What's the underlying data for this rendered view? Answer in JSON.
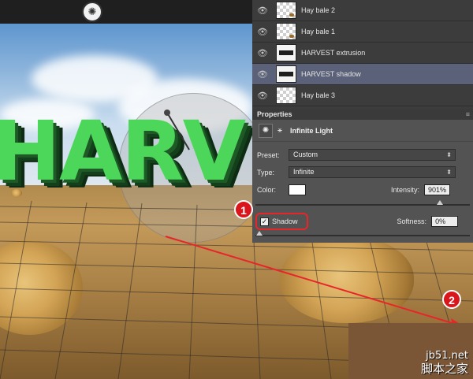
{
  "colors": {
    "accent_red": "#d9161b",
    "selected_layer": "#5a6178",
    "harvest_green": "#4cd65a"
  },
  "canvas": {
    "title_text": "HARV",
    "light_icon": "sun-icon"
  },
  "layers": [
    {
      "name": "Hay bale 2",
      "type": "image",
      "visible": true,
      "selected": false
    },
    {
      "name": "Hay bale 1",
      "type": "image",
      "visible": true,
      "selected": false
    },
    {
      "name": "HARVEST extrusion",
      "type": "3d",
      "visible": true,
      "selected": false
    },
    {
      "name": "HARVEST shadow",
      "type": "3d",
      "visible": true,
      "selected": true
    },
    {
      "name": "Hay bale 3",
      "type": "image",
      "visible": true,
      "selected": false
    }
  ],
  "properties": {
    "tab_label": "Properties",
    "light_type_title": "Infinite Light",
    "preset_label": "Preset:",
    "preset_value": "Custom",
    "type_label": "Type:",
    "type_value": "Infinite",
    "color_label": "Color:",
    "color_value": "#ffffff",
    "intensity_label": "Intensity:",
    "intensity_value": "901%",
    "shadow_label": "Shadow",
    "shadow_checked": true,
    "softness_label": "Softness:",
    "softness_value": "0%"
  },
  "annotations": {
    "step1": "1",
    "step2": "2"
  },
  "watermark": {
    "domain": "jb51.net",
    "chinese": "脚本之家"
  }
}
